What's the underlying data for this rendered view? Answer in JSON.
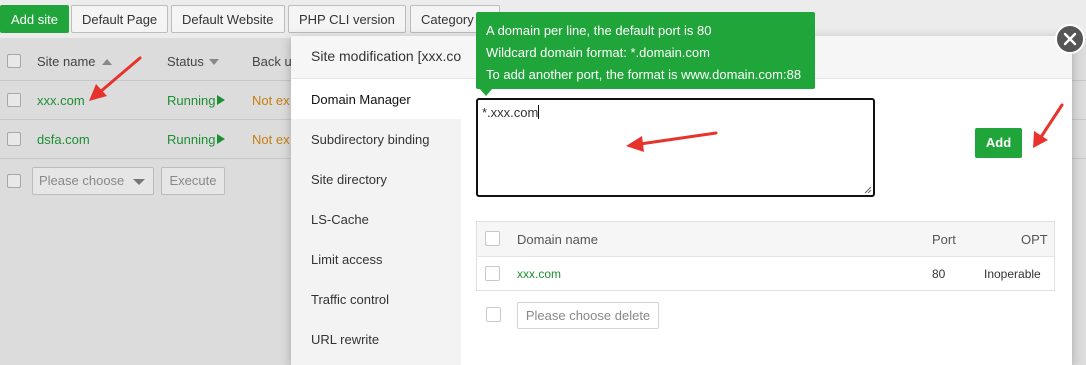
{
  "toolbar": {
    "buttons": [
      "Add site",
      "Default Page",
      "Default Website",
      "PHP CLI version",
      "Category"
    ]
  },
  "site_list": {
    "headers": {
      "name": "Site name",
      "status": "Status",
      "backup": "Back u"
    },
    "rows": [
      {
        "name": "xxx.com",
        "status": "Running",
        "backup": "Not ex"
      },
      {
        "name": "dsfa.com",
        "status": "Running",
        "backup": "Not ex"
      }
    ],
    "batch": {
      "select_placeholder": "Please choose",
      "execute_label": "Execute"
    }
  },
  "tooltip": {
    "lines": [
      "A domain per line, the default port is 80",
      "Wildcard domain format: *.domain.com",
      "To add another port, the format is www.domain.com:88"
    ]
  },
  "dialog": {
    "title": "Site modification [xxx.co",
    "menu": [
      "Domain Manager",
      "Subdirectory binding",
      "Site directory",
      "LS-Cache",
      "Limit access",
      "Traffic control",
      "URL rewrite"
    ],
    "active_menu": "Domain Manager",
    "domain_input_value": "*.xxx.com",
    "add_label": "Add",
    "table": {
      "headers": {
        "domain": "Domain name",
        "port": "Port",
        "opt": "OPT"
      },
      "rows": [
        {
          "domain": "xxx.com",
          "port": "80",
          "opt": "Inoperable"
        }
      ]
    },
    "delete_label": "Please choose delete"
  },
  "colors": {
    "accent_green": "#20a53a",
    "running_green": "#1d8f33",
    "warning_orange": "#c57f0e",
    "annotation_red": "#e8322c"
  }
}
